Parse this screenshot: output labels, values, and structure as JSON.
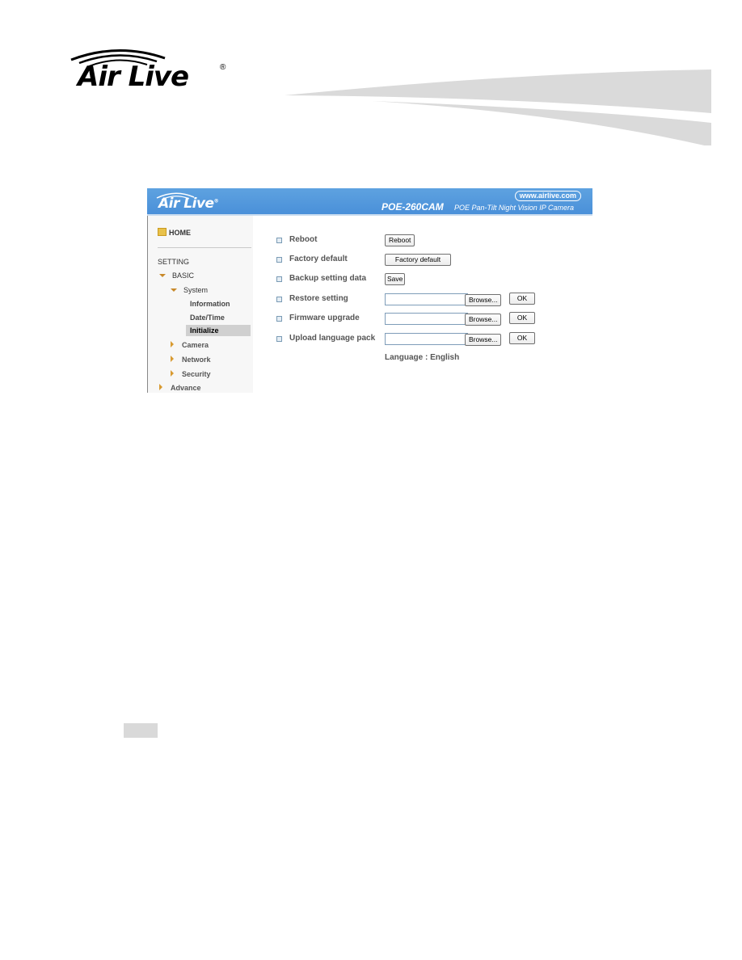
{
  "page": {
    "logo_text": "Air Live",
    "logo_reg": "®"
  },
  "screenshot": {
    "banner": {
      "logo_text": "Air Live",
      "logo_reg": "®",
      "url": "www.airlive.com",
      "model": "POE-260CAM",
      "description": "POE Pan-Tilt Night Vision IP Camera",
      "color": "#4a90d9"
    },
    "sidebar": {
      "home": "HOME",
      "setting": "SETTING",
      "items": [
        {
          "label": "BASIC",
          "level": 1,
          "state": "expanded"
        },
        {
          "label": "System",
          "level": 2,
          "state": "expanded"
        },
        {
          "label": "Information",
          "level": 3
        },
        {
          "label": "Date/Time",
          "level": 3
        },
        {
          "label": "Initialize",
          "level": 3,
          "selected": true
        },
        {
          "label": "Camera",
          "level": 2,
          "state": "collapsed"
        },
        {
          "label": "Network",
          "level": 2,
          "state": "collapsed"
        },
        {
          "label": "Security",
          "level": 2,
          "state": "collapsed"
        },
        {
          "label": "Advance",
          "level": 1,
          "state": "collapsed"
        }
      ]
    },
    "content": {
      "rows": [
        {
          "label": "Reboot",
          "button": "Reboot"
        },
        {
          "label": "Factory default",
          "button": "Factory default"
        },
        {
          "label": "Backup setting data",
          "button": "Save"
        },
        {
          "label": "Restore setting",
          "file_value": "",
          "browse": "Browse...",
          "ok": "OK"
        },
        {
          "label": "Firmware upgrade",
          "file_value": "",
          "browse": "Browse...",
          "ok": "OK"
        },
        {
          "label": "Upload language pack",
          "file_value": "",
          "browse": "Browse...",
          "ok": "OK"
        }
      ],
      "language_label": "Language : English"
    }
  }
}
